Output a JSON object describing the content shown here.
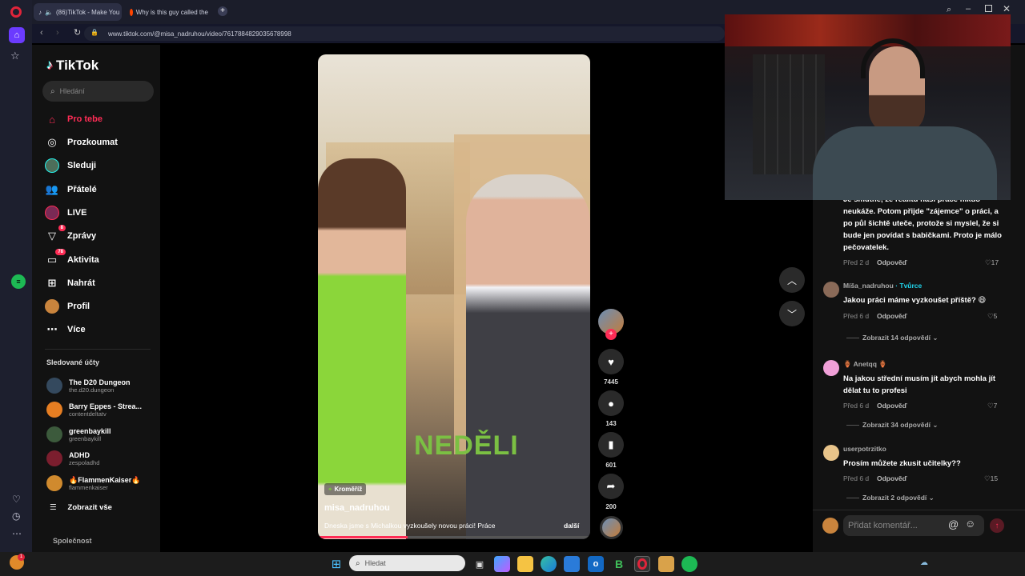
{
  "browser": {
    "tabs": [
      {
        "label": "(86)TikTok - Make You"
      },
      {
        "label": "Why is this guy called the"
      }
    ],
    "url": "www.tiktok.com/@misa_nadruhou/video/7617884829035678998"
  },
  "tiktok": {
    "logo": "TikTok",
    "search_placeholder": "Hledání",
    "nav": [
      {
        "label": "Pro tebe",
        "icon": "home-icon"
      },
      {
        "label": "Prozkoumat",
        "icon": "compass-icon"
      },
      {
        "label": "Sleduji",
        "icon": "following-avatar-icon"
      },
      {
        "label": "Přátelé",
        "icon": "friends-icon"
      },
      {
        "label": "LIVE",
        "icon": "live-icon"
      },
      {
        "label": "Zprávy",
        "icon": "messages-icon",
        "badge": "8"
      },
      {
        "label": "Aktivita",
        "icon": "activity-icon",
        "badge": "78"
      },
      {
        "label": "Nahrát",
        "icon": "upload-icon"
      },
      {
        "label": "Profil",
        "icon": "profile-icon"
      },
      {
        "label": "Více",
        "icon": "more-icon"
      }
    ],
    "followed_heading": "Sledované účty",
    "followed": [
      {
        "name": "The D20 Dungeon",
        "handle": "the.d20.dungeon"
      },
      {
        "name": "Barry Eppes - Strea...",
        "handle": "contentdeltatv"
      },
      {
        "name": "greenbaykill",
        "handle": "greenbaykill"
      },
      {
        "name": "ADHD",
        "handle": "zespoladhd"
      },
      {
        "name": "🔥FlammenKaiser🔥",
        "handle": "flammenkaiser"
      }
    ],
    "show_all": "Zobrazit vše",
    "footer": "Společnost"
  },
  "video": {
    "location": "Kroměříž",
    "author": "misa_nadruhou",
    "caption": "Dneska jsme s Michalkou vyzkoušely novou práci! Práce",
    "more": "další",
    "overlay_text": "NEDĚLI",
    "likes": "7445",
    "comments": "143",
    "saves": "601",
    "shares": "200"
  },
  "comments": {
    "items": [
      {
        "text": "Je smutné, že realitu naší práce nikdo neukáže. Potom přijde \"zájemce\" o práci, a po půl šichtě uteče, protože si myslel, že si bude jen povídat s babičkami. Proto je málo pečovatelek.",
        "time": "Před 2 d",
        "reply": "Odpověď",
        "likes": "17"
      },
      {
        "user": "Míša_nadruhou",
        "creator": "· Tvůrce",
        "text": "Jakou práci máme vyzkoušet příště? 😄",
        "time": "Před 6 d",
        "reply": "Odpověď",
        "likes": "5",
        "more": "Zobrazit 14 odpovědí"
      },
      {
        "user": "🏺 Anetqq 🏺",
        "text": "Na jakou střední musím jít abych mohla jít dělat tu to profesi",
        "time": "Před 6 d",
        "reply": "Odpověď",
        "likes": "7",
        "more": "Zobrazit 34 odpovědí"
      },
      {
        "user": "userpotrzitko",
        "text": "Prosím můžete zkusit učitelky??",
        "time": "Před 6 d",
        "reply": "Odpověď",
        "likes": "15",
        "more": "Zobrazit 2 odpovědí"
      }
    ],
    "input_placeholder": "Přidat komentář..."
  },
  "taskbar": {
    "search_placeholder": "Hledat",
    "notification_count": "1"
  },
  "colors": {
    "accent": "#fe2c55",
    "creator": "#20d5ec"
  }
}
